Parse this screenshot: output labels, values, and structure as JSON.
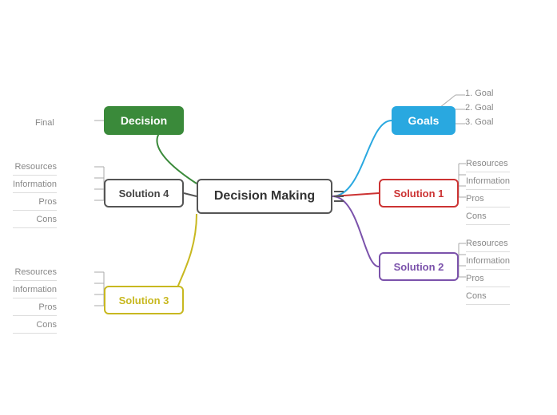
{
  "title": "Decision Making",
  "central": {
    "label": "Decision Making"
  },
  "nodes": {
    "decision": "Decision",
    "goals": "Goals",
    "solution1": "Solution 1",
    "solution2": "Solution 2",
    "solution3": "Solution 3",
    "solution4": "Solution 4"
  },
  "goals_list": [
    "1. Goal",
    "2. Goal",
    "3. Goal"
  ],
  "sol1_branches": [
    "Resources",
    "Information",
    "Pros",
    "Cons"
  ],
  "sol2_branches": [
    "Resources",
    "Information",
    "Pros",
    "Cons"
  ],
  "sol3_branches": [
    "Resources",
    "Information",
    "Pros",
    "Cons"
  ],
  "sol4_branches": [
    "Resources",
    "Information",
    "Pros",
    "Cons"
  ],
  "decision_branch": "Final",
  "colors": {
    "central_border": "#555555",
    "decision_bg": "#3a8a3a",
    "goals_bg": "#29a8e0",
    "sol1_border": "#cc3333",
    "sol2_border": "#7b52ab",
    "sol3_border": "#c8b820",
    "sol4_border": "#555555",
    "conn_decision": "#3a8a3a",
    "conn_goals": "#29a8e0",
    "conn_sol1": "#cc3333",
    "conn_sol2": "#7b52ab",
    "conn_sol3": "#c8b820",
    "conn_sol4": "#555555"
  }
}
